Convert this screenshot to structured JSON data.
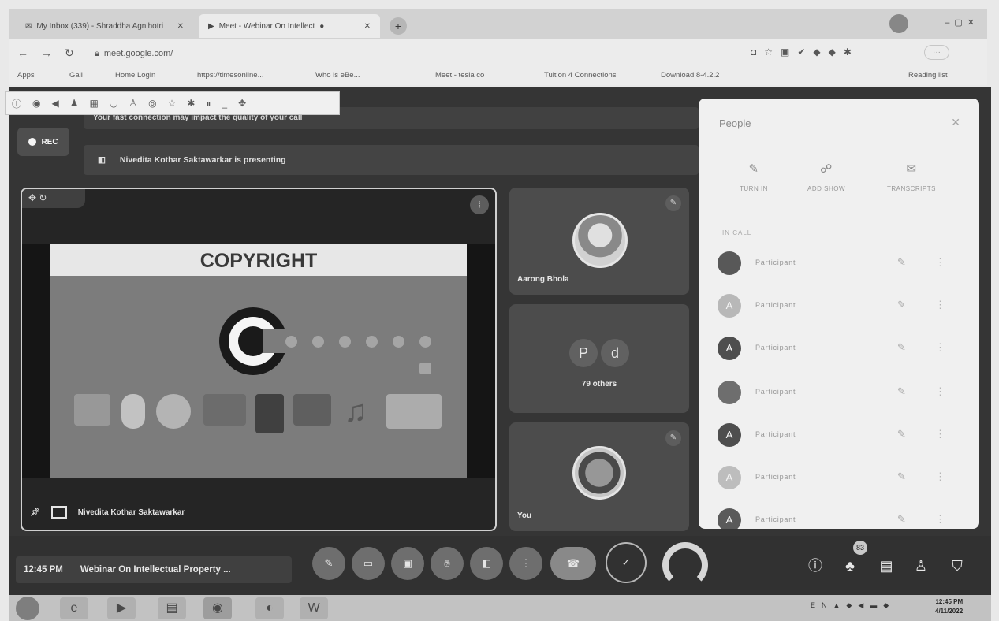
{
  "browser": {
    "tabs": [
      {
        "label": "My Inbox (339) - Shraddha Agnihotri"
      },
      {
        "label": "Meet - Webinar On Intellect"
      }
    ],
    "url": "meet.google.com/",
    "bookmarks": [
      "Apps",
      "Gall",
      "Home Login",
      "https://timesonline...",
      "Who is eBe...",
      "Meet - tesla co",
      "Tuition 4 Connections",
      "Download 8-4.2.2",
      "Reading list"
    ]
  },
  "meet": {
    "notice_text": "Your fast connection may impact the quality of your call",
    "rec_label": "REC",
    "presenting_text": "Nivedita Kothar Saktawarkar is presenting",
    "main": {
      "slide_title": "COPYRIGHT",
      "presenter_name": "Nivedita Kothar Saktawarkar"
    },
    "tiles": [
      {
        "name": "Aarong Bhola"
      },
      {
        "bubbles": [
          "P",
          "d"
        ],
        "others_label": "79 others"
      },
      {
        "name": "You"
      }
    ],
    "footer": {
      "time": "12:45 PM",
      "meeting_title": "Webinar On Intellectual Property ..."
    },
    "participant_badge": "83"
  },
  "people_panel": {
    "title": "People",
    "actions": [
      "TURN IN",
      "ADD SHOW",
      "TRANSCRIPTS"
    ],
    "section_label": "IN CALL",
    "participants": [
      {
        "initial": "",
        "name": "Participant",
        "avatar_color": "#555555"
      },
      {
        "initial": "A",
        "name": "Participant",
        "avatar_color": "#bdbdbd"
      },
      {
        "initial": "A",
        "name": "Participant",
        "avatar_color": "#4a4a4a"
      },
      {
        "initial": "",
        "name": "Participant",
        "avatar_color": "#6d6d6d"
      },
      {
        "initial": "A",
        "name": "Participant",
        "avatar_color": "#4a4a4a"
      },
      {
        "initial": "A",
        "name": "Participant",
        "avatar_color": "#c2c2c2"
      },
      {
        "initial": "A",
        "name": "Participant",
        "avatar_color": "#575757"
      }
    ]
  },
  "taskbar": {
    "clock_time": "12:45 PM",
    "clock_date": "4/11/2022"
  }
}
